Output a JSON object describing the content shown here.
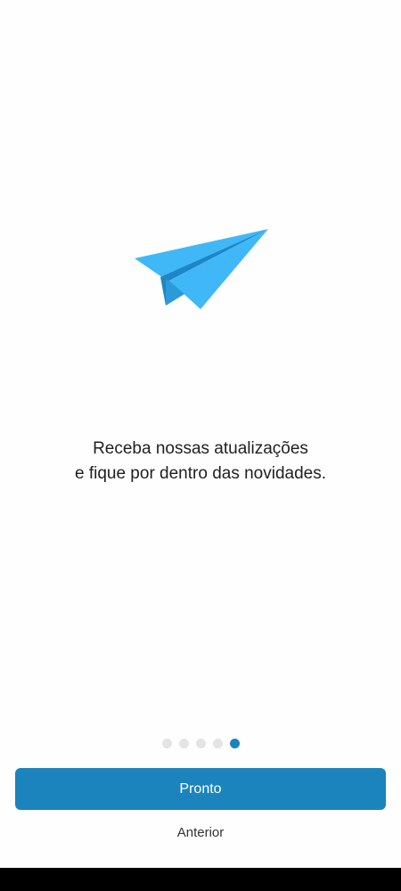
{
  "onboarding": {
    "message_line_1": "Receba nossas atualizações",
    "message_line_2": "e fique por dentro das novidades.",
    "illustration_icon": "paper-plane-icon",
    "pages_total": 5,
    "current_page": 5,
    "primary_button_label": "Pronto",
    "secondary_button_label": "Anterior"
  },
  "colors": {
    "accent": "#1b84bd",
    "plane_light": "#40b8f8",
    "plane_dark": "#1e86c6",
    "dot_inactive": "#e4e4e4",
    "background": "#fefefe",
    "text": "#1f1f1f",
    "system_nav_bar": "#000000"
  }
}
